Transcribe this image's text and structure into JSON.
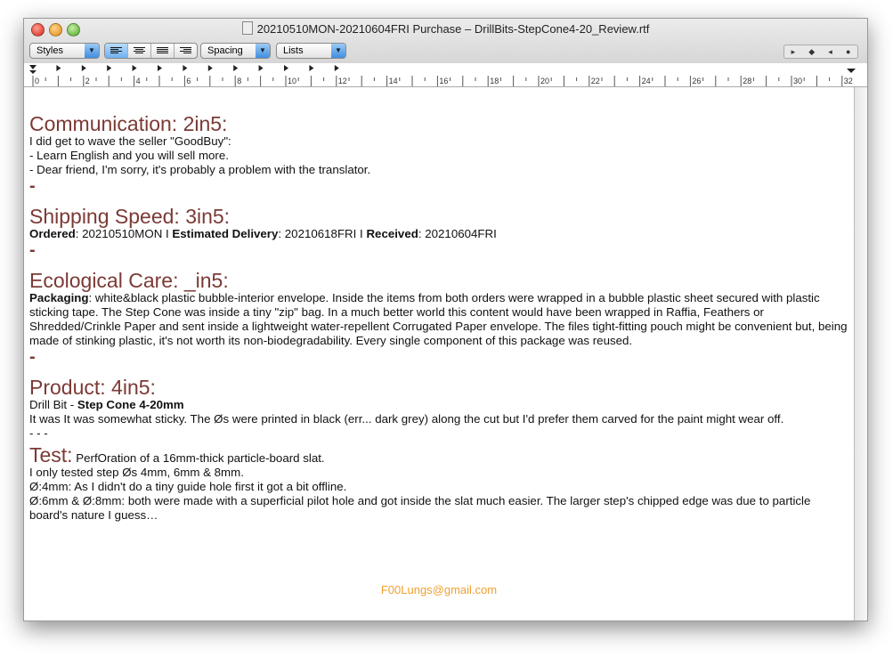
{
  "window": {
    "title": "20210510MON-20210604FRI Purchase – DrillBits-StepCone4-20_Review.rtf"
  },
  "toolbar": {
    "styles": "Styles",
    "spacing": "Spacing",
    "lists": "Lists",
    "nav": [
      "▸",
      "◆",
      "◂",
      "●"
    ]
  },
  "ruler": {
    "labels": [
      "0",
      "2",
      "4",
      "6",
      "8",
      "10",
      "12",
      "14",
      "16",
      "18",
      "20",
      "22",
      "24",
      "26",
      "28",
      "30",
      "32"
    ]
  },
  "doc": {
    "communication": {
      "heading": "Communication: 2in5:",
      "lines": [
        "I did get to wave the seller \"GoodBuy\":",
        "- Learn English and you will sell more.",
        "- Dear friend, I'm sorry, it's probably a problem with the translator."
      ]
    },
    "sep": "-",
    "shipping": {
      "heading": "Shipping Speed: 3in5:",
      "ordered_label": "Ordered",
      "ordered": ": 20210510MON I ",
      "est_label": "Estimated Delivery",
      "est": ": 20210618FRI I ",
      "recv_label": "Received",
      "recv": ": 20210604FRI"
    },
    "eco": {
      "heading": "Ecological Care: _in5:",
      "label": "Packaging",
      "text": ": white&black plastic bubble-interior envelope. Inside the items from both orders were wrapped in a bubble plastic sheet secured with plastic sticking tape. The Step Cone was inside a tiny \"zip\" bag. In a much better world this content would have been wrapped in Raffia, Feathers or Shredded/Crinkle Paper and sent inside a lightweight water-repellent Corrugated Paper envelope. The files tight-fitting pouch might be convenient but, being made of stinking plastic, it's not worth its non-biodegradability. Every single component of this package was reused."
    },
    "product": {
      "heading": "Product: 4in5:",
      "prefix": "Drill Bit - ",
      "name": "Step Cone 4-20mm",
      "text": "It was It was somewhat sticky. The Øs were printed in black (err... dark grey) along the cut but I'd prefer them carved for the paint might wear off.",
      "sep": "- - -"
    },
    "test": {
      "heading": "Test:",
      "subtitle": " PerfOration of a 16mm-thick particle-board slat.",
      "lines": [
        "I only tested step Øs 4mm, 6mm & 8mm.",
        "Ø:4mm: As I didn't do a tiny guide hole first it got a bit offline.",
        "Ø:6mm & Ø:8mm: both were made with a superficial pilot hole and got inside the slat much easier. The larger step's chipped edge was due to particle board's nature I guess…"
      ]
    },
    "email": "F00Lungs@gmail.com"
  }
}
